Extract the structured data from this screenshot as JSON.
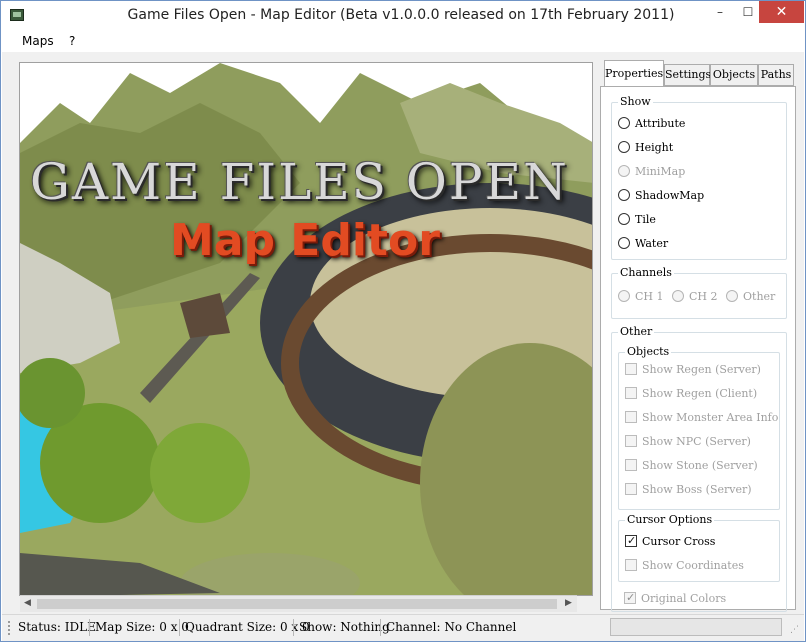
{
  "window": {
    "title": "Game Files Open - Map Editor (Beta v1.0.0.0 released on 17th February 2011)",
    "minimize": "–",
    "maximize": "☐",
    "close": "✕"
  },
  "menu": {
    "items": [
      "Maps",
      "?"
    ]
  },
  "viewport": {
    "logo_title": "GAME FILES OPEN",
    "logo_subtitle": "Map Editor"
  },
  "tabs": [
    "Properties",
    "Settings",
    "Objects",
    "Paths"
  ],
  "show": {
    "label": "Show",
    "options": [
      {
        "label": "Attribute",
        "enabled": true
      },
      {
        "label": "Height",
        "enabled": true
      },
      {
        "label": "MiniMap",
        "enabled": false
      },
      {
        "label": "ShadowMap",
        "enabled": true
      },
      {
        "label": "Tile",
        "enabled": true
      },
      {
        "label": "Water",
        "enabled": true
      }
    ]
  },
  "channels": {
    "label": "Channels",
    "options": [
      "CH 1",
      "CH 2",
      "Other"
    ]
  },
  "other": {
    "label": "Other",
    "objects_label": "Objects",
    "objects": [
      "Show Regen (Server)",
      "Show Regen (Client)",
      "Show Monster Area Info",
      "Show NPC (Server)",
      "Show Stone (Server)",
      "Show Boss (Server)"
    ],
    "cursor_label": "Cursor Options",
    "cursor_cross": "Cursor Cross",
    "show_coordinates": "Show Coordinates",
    "original_colors": "Original Colors"
  },
  "status": {
    "state": "Status: IDLE",
    "map_size": "Map Size: 0 x 0",
    "quadrant_size": "Quadrant Size: 0 x 0",
    "show": "Show: Nothing",
    "channel": "Channel: No Channel"
  },
  "colors": {
    "close_button": "#c7453f",
    "logo_subtitle": "#e24b22",
    "window_border": "#6f93c5"
  }
}
